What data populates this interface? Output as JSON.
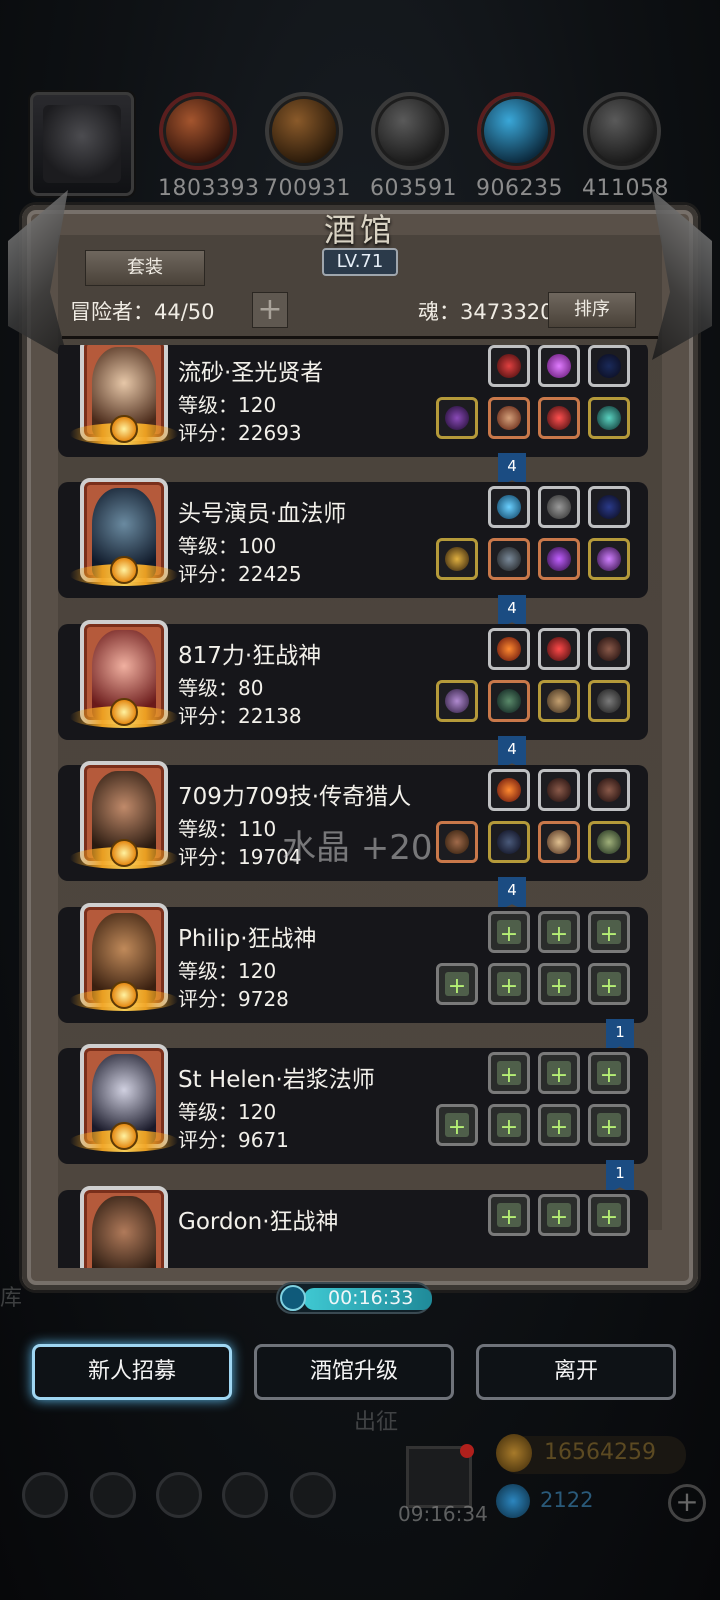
{
  "top": {
    "resources": [
      {
        "icon": "meat-icon",
        "value": "1803393"
      },
      {
        "icon": "wood-icon",
        "value": "700931"
      },
      {
        "icon": "stone-icon",
        "value": "603591"
      },
      {
        "icon": "crystal-icon",
        "value": "906235"
      },
      {
        "icon": "iron-icon",
        "value": "411058"
      }
    ]
  },
  "panel": {
    "title": "酒馆",
    "level": "LV.71",
    "set_button": "套装",
    "adventurers": "冒险者：44/50",
    "add_label": "+",
    "soul": "魂：3473320",
    "sort_button": "排序"
  },
  "heroes": [
    {
      "name": "流砂·圣光贤者",
      "level": "等级：120",
      "score": "评分：22693",
      "ribbon": "4"
    },
    {
      "name": "头号演员·血法师",
      "level": "等级：100",
      "score": "评分：22425",
      "ribbon": "4"
    },
    {
      "name": "817力·狂战神",
      "level": "等级：80",
      "score": "评分：22138",
      "ribbon": "4"
    },
    {
      "name": "709力709技·传奇猎人",
      "level": "等级：110",
      "score": "评分：19704",
      "ribbon": "4"
    },
    {
      "name": "Philip·狂战神",
      "level": "等级：120",
      "score": "评分：9728",
      "ribbon": "1"
    },
    {
      "name": "St Helen·岩浆法师",
      "level": "等级：120",
      "score": "评分：9671",
      "ribbon": "1"
    },
    {
      "name": "Gordon·狂战神",
      "level": "",
      "score": "",
      "ribbon": ""
    }
  ],
  "floating_text": "水晶 +20",
  "timer": "00:16:33",
  "bottom_buttons": {
    "recruit": "新人招募",
    "upgrade": "酒馆升级",
    "leave": "离开"
  },
  "background": {
    "expedition": "出征",
    "gold": "16564259",
    "gems": "2122",
    "clock": "09:16:34",
    "side_char": "库"
  }
}
